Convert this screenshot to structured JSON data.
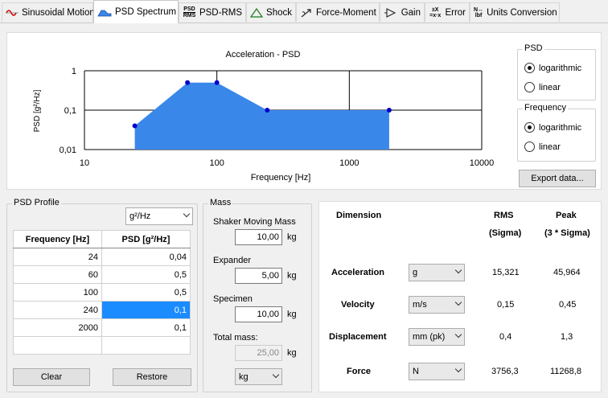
{
  "tabs": [
    {
      "label": "Sinusoidal Motion",
      "icon": "sine-wave-icon"
    },
    {
      "label": "PSD Spectrum",
      "icon": "psd-spectrum-icon"
    },
    {
      "label": "PSD-RMS",
      "icon": "psd-rms-icon"
    },
    {
      "label": "Shock",
      "icon": "shock-icon"
    },
    {
      "label": "Force-Moment",
      "icon": "force-moment-icon"
    },
    {
      "label": "Gain",
      "icon": "gain-icon"
    },
    {
      "label": "Error",
      "icon": "error-icon"
    },
    {
      "label": "Units Conversion",
      "icon": "units-conversion-icon"
    }
  ],
  "tab_icon_text": {
    "psd_rms_top": "PSD",
    "psd_rms_bottom": "RMS",
    "error_top": "±X",
    "error_bottom": "=x·x",
    "units_top": "N↔",
    "units_bottom": "lbf"
  },
  "chart_data": {
    "type": "area",
    "title": "Acceleration - PSD",
    "xlabel": "Frequency [Hz]",
    "ylabel": "PSD [g²/Hz]",
    "xscale": "log",
    "yscale": "log",
    "xlim": [
      10,
      10000
    ],
    "ylim": [
      0.01,
      1
    ],
    "xticks": [
      "10",
      "100",
      "1000",
      "10000"
    ],
    "yticks": [
      "1",
      "0,1",
      "0,01"
    ],
    "x": [
      24,
      60,
      100,
      240,
      2000
    ],
    "y": [
      0.04,
      0.5,
      0.5,
      0.1,
      0.1
    ],
    "fill_color": "#3a87ea",
    "point_color": "#0000cc",
    "grid": "major lines at decades"
  },
  "psd_group": {
    "title": "PSD",
    "options": [
      "logarithmic",
      "linear"
    ],
    "selected": "logarithmic"
  },
  "frequency_group": {
    "title": "Frequency",
    "options": [
      "logarithmic",
      "linear"
    ],
    "selected": "logarithmic"
  },
  "export_button": "Export data...",
  "profile": {
    "title": "PSD Profile",
    "unit_select": "g²/Hz",
    "headers": [
      "Frequency [Hz]",
      "PSD [g²/Hz]"
    ],
    "rows": [
      [
        "24",
        "0,04"
      ],
      [
        "60",
        "0,5"
      ],
      [
        "100",
        "0,5"
      ],
      [
        "240",
        "0,1"
      ],
      [
        "2000",
        "0,1"
      ],
      [
        "",
        ""
      ]
    ],
    "clear_button": "Clear",
    "restore_button": "Restore"
  },
  "mass": {
    "title": "Mass",
    "shaker_label": "Shaker Moving Mass",
    "shaker_value": "10,00",
    "expander_label": "Expander",
    "expander_value": "5,00",
    "specimen_label": "Specimen",
    "specimen_value": "10,00",
    "total_label": "Total mass:",
    "total_value": "25,00",
    "unit": "kg",
    "unit_select": "kg"
  },
  "results": {
    "dimension_header": "Dimension",
    "rms_header": "RMS",
    "rms_sub": "(Sigma)",
    "peak_header": "Peak",
    "peak_sub": "(3 * Sigma)",
    "rows": [
      {
        "name": "Acceleration",
        "unit": "g",
        "rms": "15,321",
        "peak": "45,964"
      },
      {
        "name": "Velocity",
        "unit": "m/s",
        "rms": "0,15",
        "peak": "0,45"
      },
      {
        "name": "Displacement",
        "unit": "mm (pk)",
        "rms": "0,4",
        "peak": "1,3"
      },
      {
        "name": "Force",
        "unit": "N",
        "rms": "3756,3",
        "peak": "11268,8"
      }
    ]
  }
}
